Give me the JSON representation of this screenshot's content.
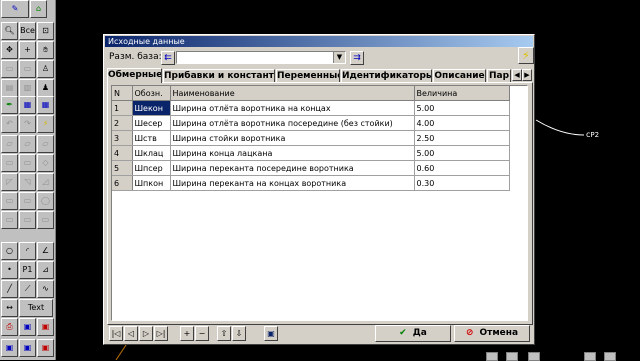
{
  "dialog": {
    "title": "Исходные данные",
    "base_label": "Разм. база:",
    "base_value": "",
    "tabs": [
      "Обмерные",
      "Прибавки и константы",
      "Переменные",
      "Идентификаторы",
      "Описание",
      "Пар"
    ],
    "active_tab_index": 0,
    "columns": [
      "N",
      "Обозн.",
      "Наименование",
      "Величина"
    ],
    "rows": [
      {
        "n": "1",
        "code": "Шекон",
        "name": "Ширина отлёта воротника на концах",
        "value": "5.00",
        "selected_code": true
      },
      {
        "n": "2",
        "code": "Шесер",
        "name": "Ширина отлёта воротника посередине (без стойки)",
        "value": "4.00"
      },
      {
        "n": "3",
        "code": "Шств",
        "name": "Ширина стойки воротника",
        "value": "2.50"
      },
      {
        "n": "4",
        "code": "Шклац",
        "name": "Ширина конца лацкана",
        "value": "5.00"
      },
      {
        "n": "5",
        "code": "Шпсер",
        "name": "Ширина переканта посередине воротника",
        "value": "0.60"
      },
      {
        "n": "6",
        "code": "Шпкон",
        "name": "Ширина переканта на концах воротника",
        "value": "0.30"
      }
    ],
    "ok_label": "Да",
    "cancel_label": "Отмена"
  },
  "toolbar": {
    "top_icons": [
      "pencil-icon",
      "building-icon"
    ],
    "labels": {
      "all": "Все",
      "text": "Text",
      "p1": "P1"
    }
  },
  "canvas": {
    "point_label": "P2",
    "curve_color": "#ffffff"
  },
  "colors": {
    "selection": "#0a246a",
    "title_start": "#0a246a",
    "title_end": "#a6caf0",
    "dialog_face": "#d4d0c8",
    "ok_check": "#008000",
    "cancel_mark": "#d00000",
    "lightning": "#e0c000"
  }
}
